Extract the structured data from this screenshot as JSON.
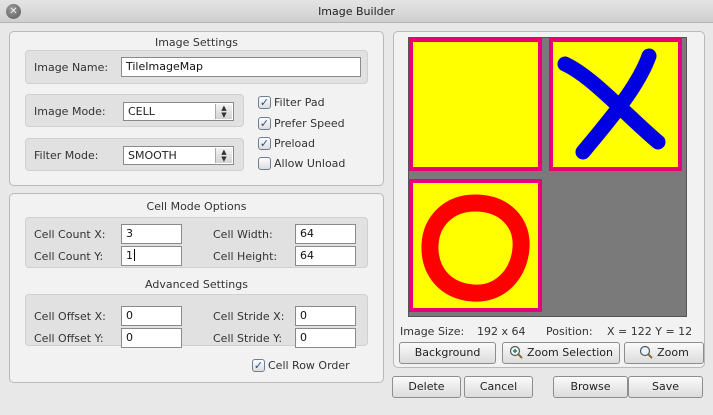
{
  "window": {
    "title": "Image Builder"
  },
  "image_settings": {
    "title": "Image Settings",
    "name_label": "Image Name:",
    "name_value": "TileImageMap",
    "mode_label": "Image Mode:",
    "mode_value": "CELL",
    "filter_label": "Filter Mode:",
    "filter_value": "SMOOTH",
    "checkboxes": [
      {
        "label": "Filter Pad",
        "checked": true
      },
      {
        "label": "Prefer Speed",
        "checked": true
      },
      {
        "label": "Preload",
        "checked": true
      },
      {
        "label": "Allow Unload",
        "checked": false
      }
    ]
  },
  "cell_mode": {
    "title": "Cell Mode Options",
    "count_x_label": "Cell Count X:",
    "count_x_value": "3",
    "count_y_label": "Cell Count Y:",
    "count_y_value": "1",
    "width_label": "Cell Width:",
    "width_value": "64",
    "height_label": "Cell Height:",
    "height_value": "64"
  },
  "advanced": {
    "title": "Advanced Settings",
    "offset_x_label": "Cell Offset X:",
    "offset_x_value": "0",
    "offset_y_label": "Cell Offset Y:",
    "offset_y_value": "0",
    "stride_x_label": "Cell Stride X:",
    "stride_x_value": "0",
    "stride_y_label": "Cell Stride Y:",
    "stride_y_value": "0",
    "row_order_label": "Cell Row Order",
    "row_order_checked": true
  },
  "preview": {
    "size_label": "Image Size:",
    "size_value": "192 x 64",
    "position_label": "Position:",
    "position_value": "X = 122 Y = 12",
    "background_button": "Background",
    "zoom_selection_button": "Zoom Selection",
    "zoom_button": "Zoom",
    "tile_border_color": "#e8007a",
    "tile_fill_color": "#ffff00",
    "x_stroke_color": "#0000e0",
    "o_stroke_color": "#ff0000"
  },
  "actions": {
    "delete": "Delete",
    "cancel": "Cancel",
    "browse": "Browse",
    "save": "Save"
  },
  "icons": {
    "close": "✕",
    "check": "✓",
    "dropdown_up": "▲",
    "dropdown_down": "▼"
  }
}
